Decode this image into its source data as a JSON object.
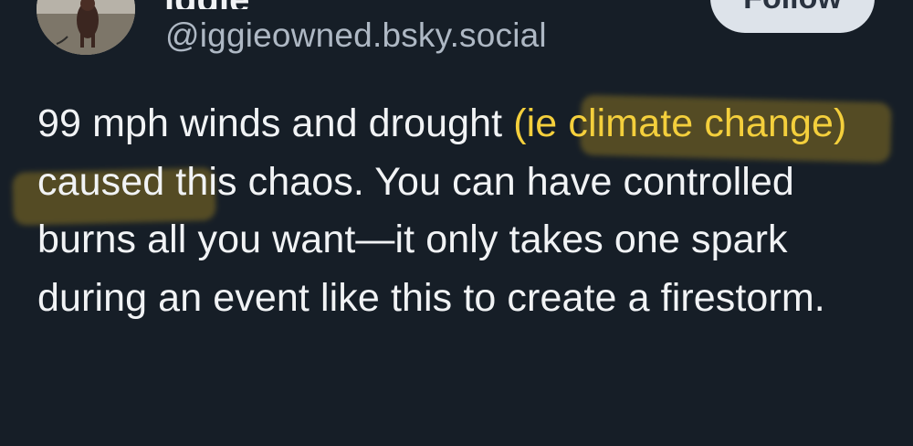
{
  "author": {
    "display_name": "iggie",
    "handle": "@iggieowned.bsky.social"
  },
  "follow_button": {
    "label": "Follow"
  },
  "post": {
    "text_before": "99 mph winds and drought ",
    "highlighted": "(ie climate change)",
    "text_after": " caused this chaos. You can have controlled burns all you want—it only takes one spark during an event like this to create a firestorm."
  },
  "colors": {
    "background": "#161e27",
    "text": "#f1f3f5",
    "handle": "#aeb8c4",
    "highlight_text": "#f4cf3c",
    "highlighter": "#d6aa1e"
  }
}
